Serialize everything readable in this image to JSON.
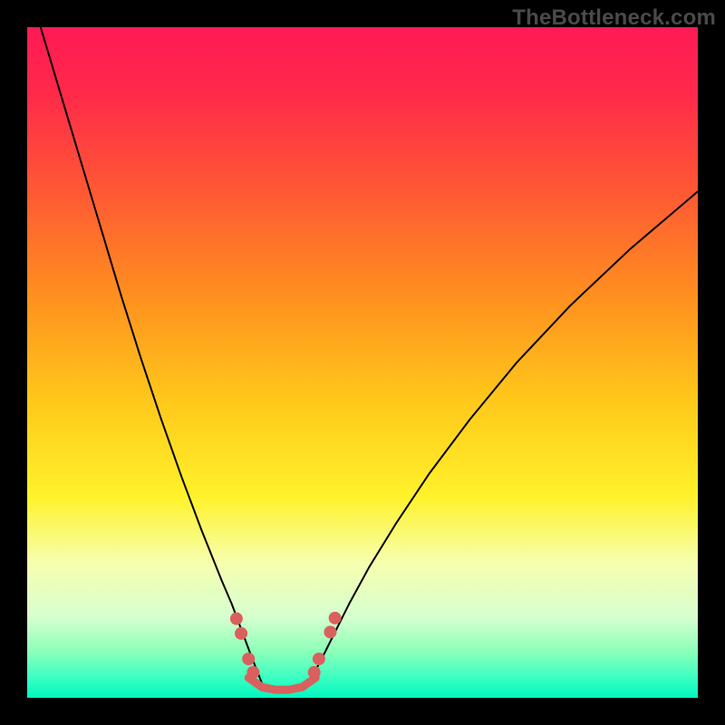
{
  "watermark": "TheBottleneck.com",
  "chart_data": {
    "type": "line",
    "title": "",
    "xlabel": "",
    "ylabel": "",
    "xlim": [
      0,
      100
    ],
    "ylim": [
      0,
      100
    ],
    "grid": false,
    "legend": false,
    "gradient_stops": [
      {
        "offset": 0.0,
        "color": "#ff1a55"
      },
      {
        "offset": 0.1,
        "color": "#ff2a4a"
      },
      {
        "offset": 0.25,
        "color": "#ff5a33"
      },
      {
        "offset": 0.4,
        "color": "#ff8f1f"
      },
      {
        "offset": 0.55,
        "color": "#ffc61a"
      },
      {
        "offset": 0.7,
        "color": "#fff22a"
      },
      {
        "offset": 0.8,
        "color": "#f6ffb0"
      },
      {
        "offset": 0.88,
        "color": "#d6ffcf"
      },
      {
        "offset": 0.93,
        "color": "#8dffb8"
      },
      {
        "offset": 0.97,
        "color": "#3affc2"
      },
      {
        "offset": 1.0,
        "color": "#00f7c0"
      }
    ],
    "series": [
      {
        "name": "curve-left",
        "stroke": "#000000",
        "stroke_width": 2,
        "x": [
          2.0,
          5.0,
          8.0,
          11.0,
          14.0,
          17.0,
          20.0,
          23.0,
          26.0,
          29.0,
          30.5,
          32.0,
          33.5,
          35.0
        ],
        "y": [
          100.0,
          90.0,
          80.0,
          70.0,
          60.0,
          50.5,
          41.5,
          33.0,
          25.0,
          17.5,
          14.0,
          10.0,
          6.0,
          2.2
        ]
      },
      {
        "name": "curve-right",
        "stroke": "#000000",
        "stroke_width": 2,
        "x": [
          42.0,
          44.0,
          46.0,
          48.0,
          51.0,
          55.0,
          60.0,
          66.0,
          73.0,
          81.0,
          90.0,
          100.0
        ],
        "y": [
          2.2,
          6.0,
          10.0,
          14.0,
          19.5,
          26.0,
          33.5,
          41.5,
          50.0,
          58.5,
          67.0,
          75.5
        ]
      },
      {
        "name": "valley-floor",
        "stroke": "#d9605d",
        "stroke_width": 9,
        "linecap": "round",
        "x": [
          33.0,
          35.0,
          37.0,
          39.0,
          41.0,
          43.0
        ],
        "y": [
          3.0,
          1.6,
          1.2,
          1.2,
          1.6,
          3.0
        ]
      }
    ],
    "marker_clusters": [
      {
        "name": "knee-left",
        "fill": "#d9605d",
        "r": 7,
        "points": [
          {
            "x": 31.2,
            "y": 11.8
          },
          {
            "x": 31.9,
            "y": 9.6
          },
          {
            "x": 33.0,
            "y": 5.8
          },
          {
            "x": 33.7,
            "y": 3.8
          }
        ]
      },
      {
        "name": "knee-right",
        "fill": "#d9605d",
        "r": 7,
        "points": [
          {
            "x": 42.8,
            "y": 3.8
          },
          {
            "x": 43.5,
            "y": 5.8
          },
          {
            "x": 45.2,
            "y": 9.8
          },
          {
            "x": 45.9,
            "y": 11.9
          }
        ]
      }
    ]
  }
}
